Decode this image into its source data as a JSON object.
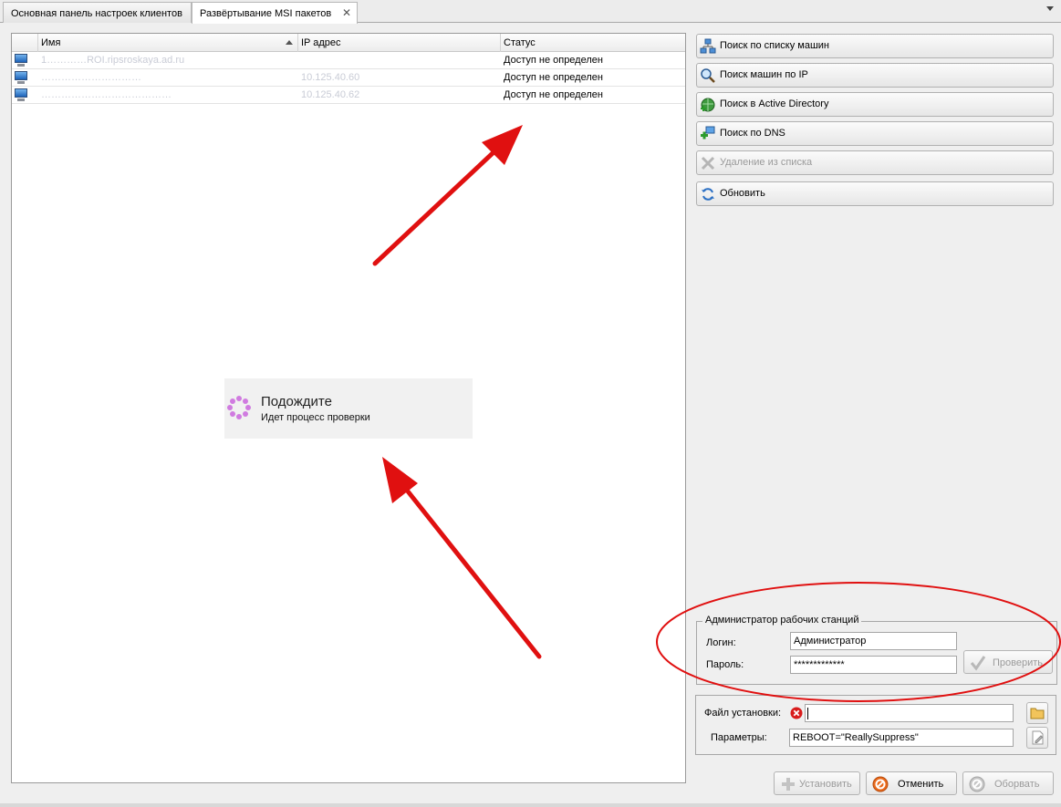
{
  "tabs": [
    {
      "label": "Основная панель настроек клиентов"
    },
    {
      "label": "Развёртывание MSI пакетов"
    }
  ],
  "grid": {
    "columns": [
      "Имя",
      "IP адрес",
      "Статус"
    ],
    "rows": [
      {
        "name": "1…………ROI.ripsroskaya.ad.ru",
        "ip": "",
        "status": "Доступ не определен"
      },
      {
        "name": "…………………………",
        "ip": "10.125.40.60",
        "status": "Доступ не определен"
      },
      {
        "name": "…………………………………",
        "ip": "10.125.40.62",
        "status": "Доступ не определен"
      }
    ]
  },
  "wait": {
    "title": "Подождите",
    "subtitle": "Идет процесс проверки"
  },
  "actions": [
    {
      "label": "Поиск по списку машин",
      "icon": "network-list-icon",
      "enabled": true
    },
    {
      "label": "Поиск машин по IP",
      "icon": "magnifier-icon",
      "enabled": true
    },
    {
      "label": "Поиск в Active Directory",
      "icon": "globe-add-icon",
      "enabled": true
    },
    {
      "label": "Поиск по DNS",
      "icon": "network-add-icon",
      "enabled": true
    },
    {
      "label": "Удаление из списка",
      "icon": "remove-icon",
      "enabled": false
    },
    {
      "label": "Обновить",
      "icon": "refresh-icon",
      "enabled": true
    }
  ],
  "admin": {
    "legend": "Администратор рабочих станций",
    "login_label": "Логин:",
    "login_value": "Администратор",
    "password_label": "Пароль:",
    "password_value": "*************",
    "check_label": "Проверить"
  },
  "install": {
    "file_label": "Файл установки:",
    "file_value": "",
    "params_label": "Параметры:",
    "params_value": "REBOOT=\"ReallySuppress\""
  },
  "footer": {
    "install_label": "Установить",
    "cancel_label": "Отменить",
    "abort_label": "Оборвать"
  },
  "colors": {
    "annotation_red": "#e01010",
    "spinner": "#d07be0",
    "error_icon": "#d81b1b"
  }
}
